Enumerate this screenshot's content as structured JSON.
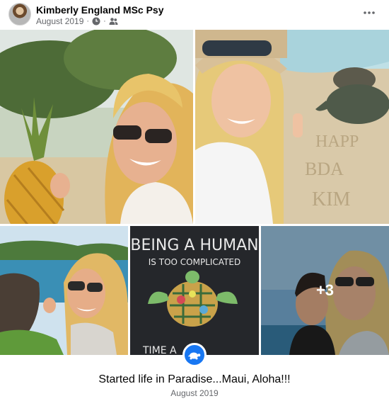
{
  "post": {
    "author": "Kimberly England MSc Psy",
    "date": "August 2019",
    "separator": "·",
    "icons": [
      "clock-icon",
      "friends-icon",
      "more-options-icon"
    ]
  },
  "photos": {
    "count": 5,
    "more_count_label": "+3",
    "shirt_text_line1": "BEING A HUMAN",
    "shirt_text_line2": "IS TOO COMPLICATED",
    "shirt_text_bottom": "TIME      A",
    "sand_text": [
      "HAPP",
      "BDA",
      "KIM"
    ]
  },
  "album": {
    "icon": "turtle-icon",
    "title": "Started life in Paradise...Maui, Aloha!!!",
    "date": "August 2019"
  },
  "colors": {
    "accent": "#1877f2",
    "secondary_text": "#65676b"
  }
}
